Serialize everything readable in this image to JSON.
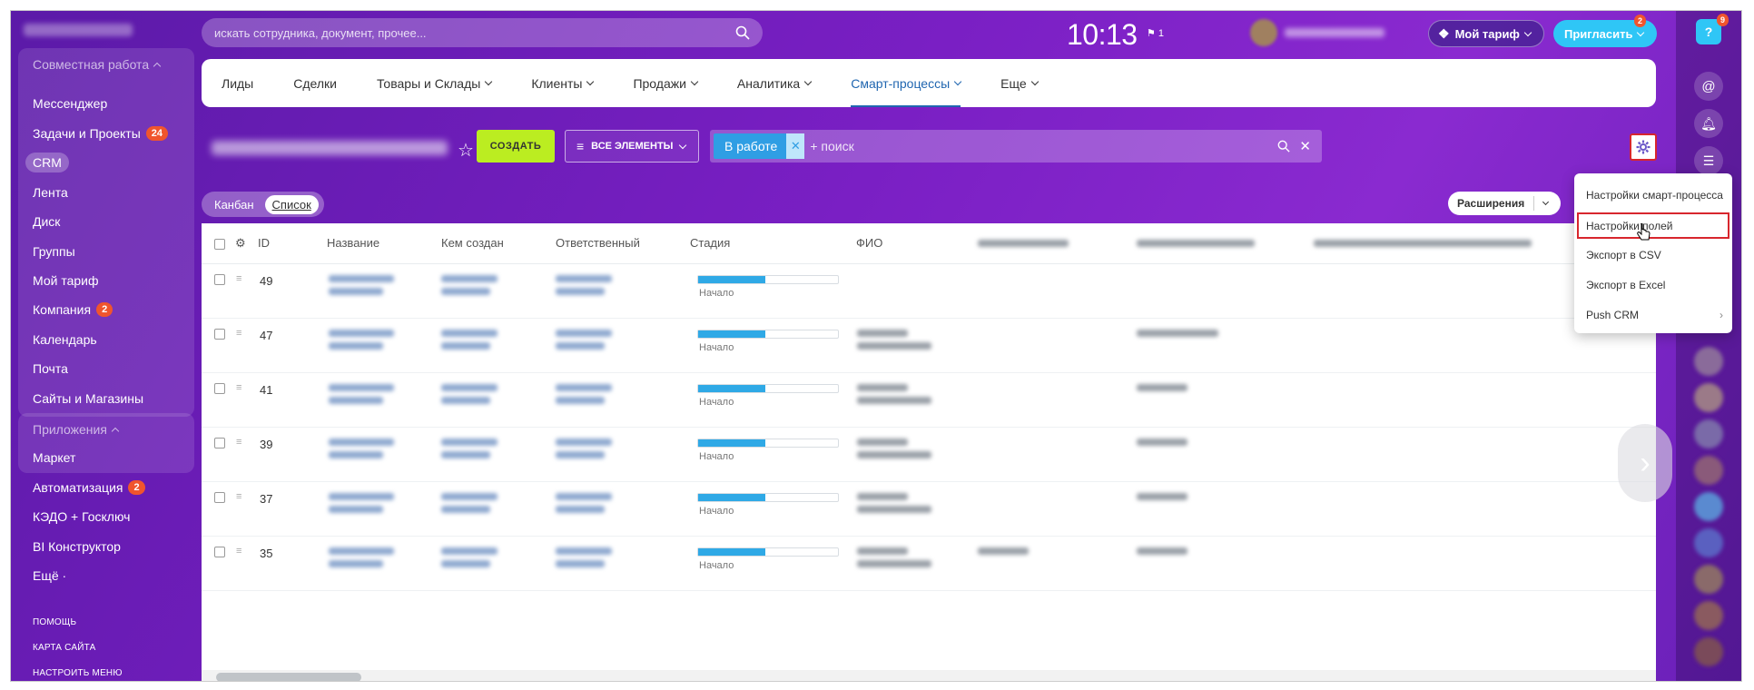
{
  "search": {
    "placeholder": "искать сотрудника, документ, прочее..."
  },
  "header": {
    "clock": "10:13",
    "flag_count": "1",
    "tariff_label": "Мой тариф",
    "invite_label": "Пригласить",
    "invite_badge": "2",
    "help_label": "?",
    "help_badge": "9"
  },
  "sidebar": {
    "group1_label": "Совместная работа",
    "items": [
      {
        "label": "Мессенджер"
      },
      {
        "label": "Задачи и Проекты",
        "badge": "24"
      },
      {
        "label": "CRM"
      },
      {
        "label": "Лента"
      },
      {
        "label": "Диск"
      },
      {
        "label": "Группы"
      },
      {
        "label": "Мой тариф"
      },
      {
        "label": "Компания",
        "badge": "2"
      },
      {
        "label": "Календарь"
      },
      {
        "label": "Почта"
      },
      {
        "label": "Сайты и Магазины"
      }
    ],
    "group2_label": "Приложения",
    "items2": [
      {
        "label": "Маркет"
      },
      {
        "label": "Автоматизация",
        "badge": "2"
      },
      {
        "label": "КЭДО + Госключ"
      },
      {
        "label": "BI Конструктор"
      },
      {
        "label": "Ещё ·"
      }
    ],
    "footer": [
      "ПОМОЩЬ",
      "КАРТА САЙТА",
      "НАСТРОИТЬ МЕНЮ"
    ]
  },
  "nav": {
    "items": [
      {
        "label": "Лиды"
      },
      {
        "label": "Сделки"
      },
      {
        "label": "Товары и Склады"
      },
      {
        "label": "Клиенты"
      },
      {
        "label": "Продажи"
      },
      {
        "label": "Аналитика"
      },
      {
        "label": "Смарт-процессы"
      },
      {
        "label": "Еще"
      }
    ]
  },
  "toolbar": {
    "create_label": "СОЗДАТЬ",
    "filter_label": "ВСЕ ЭЛЕМЕНТЫ",
    "chip_label": "В работе",
    "search_placeholder": "+ поиск"
  },
  "views": {
    "kanban": "Канбан",
    "list": "Список",
    "extensions": "Расширения"
  },
  "table": {
    "columns": {
      "id": "ID",
      "name": "Название",
      "created_by": "Кем создан",
      "responsible": "Ответственный",
      "stage": "Стадия",
      "fio": "ФИО"
    },
    "rows": [
      {
        "id": "49",
        "stage": "Начало",
        "stage_progress": 0.48
      },
      {
        "id": "47",
        "stage": "Начало",
        "stage_progress": 0.48
      },
      {
        "id": "41",
        "stage": "Начало",
        "stage_progress": 0.48
      },
      {
        "id": "39",
        "stage": "Начало",
        "stage_progress": 0.48
      },
      {
        "id": "37",
        "stage": "Начало",
        "stage_progress": 0.48
      },
      {
        "id": "35",
        "stage": "Начало",
        "stage_progress": 0.48
      }
    ]
  },
  "menu": {
    "items": [
      {
        "label": "Настройки смарт-процесса"
      },
      {
        "label": "Настройки полей"
      },
      {
        "label": "Экспорт в CSV"
      },
      {
        "label": "Экспорт в Excel"
      },
      {
        "label": "Push CRM"
      }
    ]
  },
  "colors": {
    "accent": "#7a1fc4",
    "create": "#bbed21",
    "chip": "#2f9ee4",
    "badge": "#f0552d",
    "highlight": "#d8262d",
    "stage": "#2fa9e6"
  }
}
